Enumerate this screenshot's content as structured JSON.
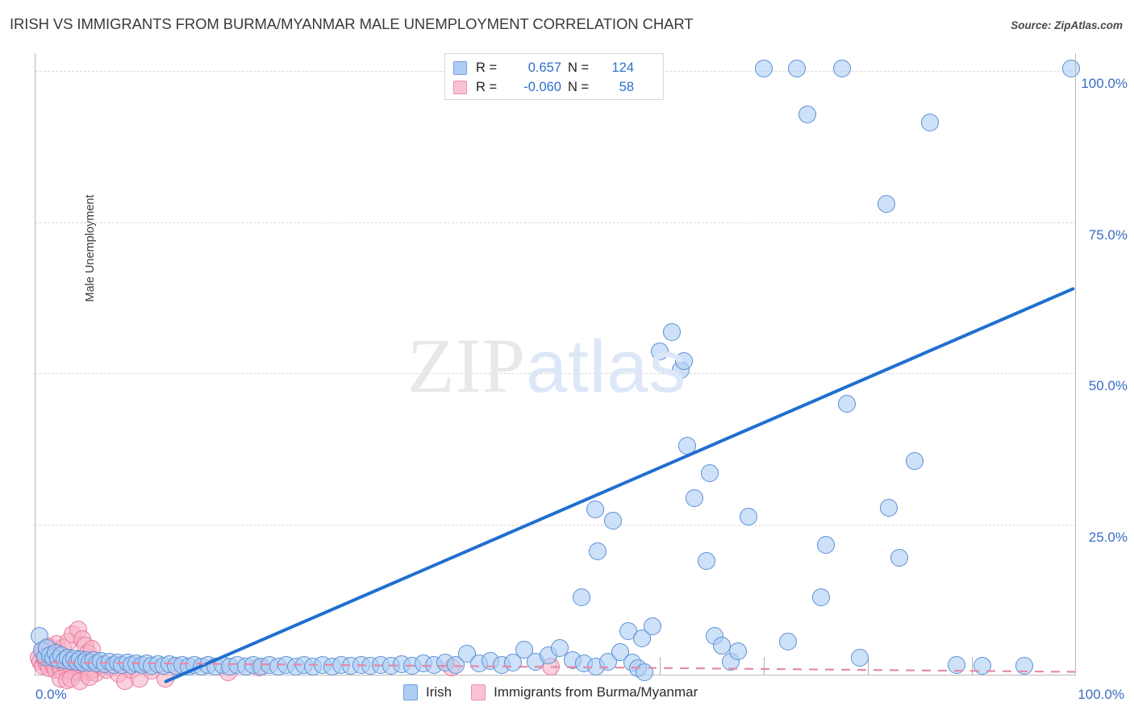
{
  "header": {
    "title": "IRISH VS IMMIGRANTS FROM BURMA/MYANMAR MALE UNEMPLOYMENT CORRELATION CHART",
    "source": "Source: ZipAtlas.com"
  },
  "watermark": {
    "part1": "ZIP",
    "part2": "atlas"
  },
  "correlation_legend": {
    "rows": [
      {
        "color": "#aecdf2",
        "r_label": "R =",
        "r_value": "0.657",
        "n_label": "N =",
        "n_value": "124"
      },
      {
        "color": "#f9c3d4",
        "r_label": "R =",
        "r_value": "-0.060",
        "n_label": "N =",
        "n_value": "58"
      }
    ]
  },
  "series_legend": [
    {
      "label": "Irish",
      "color": "#aecdf2"
    },
    {
      "label": "Immigrants from Burma/Myanmar",
      "color": "#f9c3d4"
    }
  ],
  "axes": {
    "y_title": "Male Unemployment",
    "y_ticks": [
      "100.0%",
      "75.0%",
      "50.0%",
      "25.0%"
    ],
    "x_min_label": "0.0%",
    "x_max_label": "100.0%"
  },
  "chart_data": {
    "type": "scatter",
    "title": "IRISH VS IMMIGRANTS FROM BURMA/MYANMAR MALE UNEMPLOYMENT CORRELATION CHART",
    "xlabel": "",
    "ylabel": "Male Unemployment",
    "xlim": [
      0,
      100
    ],
    "ylim": [
      0,
      103
    ],
    "grid": true,
    "legend_position": "bottom-center",
    "y_tick_values": [
      100,
      75,
      50,
      25
    ],
    "x_tick_values": [
      0,
      100
    ],
    "series": [
      {
        "name": "Irish",
        "color": "#aecdf2",
        "R": 0.657,
        "N": 124,
        "trendline": {
          "x0": 12.6,
          "y0": -1.0,
          "x1": 99.8,
          "y1": 64.0,
          "style": "solid",
          "color": "#1f6fd0"
        },
        "points": [
          [
            0.4,
            6.6
          ],
          [
            0.6,
            4.2
          ],
          [
            0.9,
            3.1
          ],
          [
            1.1,
            4.6
          ],
          [
            1.4,
            3.4
          ],
          [
            1.7,
            2.9
          ],
          [
            1.9,
            3.8
          ],
          [
            2.2,
            2.7
          ],
          [
            2.5,
            3.3
          ],
          [
            2.8,
            2.5
          ],
          [
            3.1,
            3.0
          ],
          [
            3.4,
            2.4
          ],
          [
            3.7,
            2.8
          ],
          [
            4.0,
            2.3
          ],
          [
            4.3,
            2.7
          ],
          [
            4.6,
            2.2
          ],
          [
            4.9,
            2.6
          ],
          [
            5.2,
            2.1
          ],
          [
            5.6,
            2.5
          ],
          [
            5.9,
            2.0
          ],
          [
            6.3,
            2.4
          ],
          [
            6.7,
            1.9
          ],
          [
            7.1,
            2.3
          ],
          [
            7.5,
            1.8
          ],
          [
            7.9,
            2.2
          ],
          [
            8.3,
            1.8
          ],
          [
            8.8,
            2.1
          ],
          [
            9.2,
            1.7
          ],
          [
            9.7,
            2.0
          ],
          [
            10.2,
            1.7
          ],
          [
            10.7,
            2.0
          ],
          [
            11.2,
            1.6
          ],
          [
            11.8,
            1.9
          ],
          [
            12.3,
            1.6
          ],
          [
            12.9,
            1.9
          ],
          [
            13.5,
            1.6
          ],
          [
            14.1,
            1.8
          ],
          [
            14.7,
            1.5
          ],
          [
            15.3,
            1.8
          ],
          [
            16.0,
            1.5
          ],
          [
            16.6,
            1.8
          ],
          [
            17.3,
            1.5
          ],
          [
            18.0,
            1.8
          ],
          [
            18.7,
            1.5
          ],
          [
            19.4,
            1.7
          ],
          [
            20.2,
            1.5
          ],
          [
            20.9,
            1.7
          ],
          [
            21.7,
            1.5
          ],
          [
            22.5,
            1.7
          ],
          [
            23.3,
            1.5
          ],
          [
            24.1,
            1.7
          ],
          [
            25.0,
            1.5
          ],
          [
            25.8,
            1.7
          ],
          [
            26.7,
            1.5
          ],
          [
            27.6,
            1.7
          ],
          [
            28.5,
            1.5
          ],
          [
            29.4,
            1.7
          ],
          [
            30.3,
            1.6
          ],
          [
            31.3,
            1.7
          ],
          [
            32.2,
            1.6
          ],
          [
            33.2,
            1.8
          ],
          [
            34.2,
            1.6
          ],
          [
            35.2,
            1.9
          ],
          [
            36.2,
            1.6
          ],
          [
            37.3,
            2.0
          ],
          [
            38.3,
            1.7
          ],
          [
            39.4,
            2.2
          ],
          [
            40.4,
            1.7
          ],
          [
            41.5,
            3.6
          ],
          [
            42.6,
            2.0
          ],
          [
            43.7,
            2.4
          ],
          [
            44.8,
            1.8
          ],
          [
            45.9,
            2.2
          ],
          [
            47.0,
            4.3
          ],
          [
            48.1,
            2.3
          ],
          [
            49.3,
            3.4
          ],
          [
            50.4,
            4.6
          ],
          [
            51.6,
            2.6
          ],
          [
            52.7,
            2.0
          ],
          [
            53.9,
            1.5
          ],
          [
            55.0,
            2.3
          ],
          [
            56.2,
            3.9
          ],
          [
            57.4,
            2.1
          ],
          [
            57.9,
            1.2
          ],
          [
            58.5,
            0.6
          ],
          [
            52.5,
            13.0
          ],
          [
            53.8,
            27.5
          ],
          [
            54.0,
            20.6
          ],
          [
            55.5,
            25.6
          ],
          [
            57.0,
            7.3
          ],
          [
            58.3,
            6.2
          ],
          [
            59.3,
            8.1
          ],
          [
            60.0,
            53.7
          ],
          [
            61.2,
            56.8
          ],
          [
            62.0,
            50.6
          ],
          [
            62.3,
            52.1
          ],
          [
            62.6,
            38.0
          ],
          [
            63.3,
            29.3
          ],
          [
            64.5,
            18.9
          ],
          [
            64.8,
            33.5
          ],
          [
            65.3,
            6.5
          ],
          [
            66.0,
            5.0
          ],
          [
            66.8,
            2.3
          ],
          [
            67.5,
            4.0
          ],
          [
            68.5,
            26.3
          ],
          [
            70.0,
            100.5
          ],
          [
            72.3,
            5.6
          ],
          [
            73.2,
            100.5
          ],
          [
            74.2,
            92.8
          ],
          [
            75.5,
            12.9
          ],
          [
            76.0,
            21.6
          ],
          [
            77.5,
            100.5
          ],
          [
            78.0,
            45.0
          ],
          [
            79.2,
            3.0
          ],
          [
            81.8,
            78.0
          ],
          [
            82.0,
            27.8
          ],
          [
            83.0,
            19.5
          ],
          [
            84.5,
            35.5
          ],
          [
            86.0,
            91.5
          ],
          [
            88.5,
            1.7
          ],
          [
            91.0,
            1.6
          ],
          [
            95.0,
            1.6
          ],
          [
            99.5,
            100.5
          ]
        ]
      },
      {
        "name": "Immigrants from Burma/Myanmar",
        "color": "#f9c3d4",
        "R": -0.06,
        "N": 58,
        "trendline": {
          "x0": 0,
          "y0": 2.2,
          "x1": 100,
          "y1": 0.6,
          "style": "dashed",
          "color": "#e58aa9"
        },
        "points": [
          [
            0.3,
            3.0
          ],
          [
            0.5,
            2.3
          ],
          [
            0.7,
            1.6
          ],
          [
            0.9,
            2.8
          ],
          [
            1.1,
            2.0
          ],
          [
            1.3,
            1.2
          ],
          [
            1.5,
            2.6
          ],
          [
            1.7,
            1.8
          ],
          [
            1.9,
            1.0
          ],
          [
            2.1,
            2.5
          ],
          [
            2.3,
            1.6
          ],
          [
            2.5,
            0.8
          ],
          [
            2.7,
            2.3
          ],
          [
            2.9,
            1.5
          ],
          [
            3.1,
            0.7
          ],
          [
            3.3,
            2.2
          ],
          [
            3.5,
            1.4
          ],
          [
            3.8,
            0.6
          ],
          [
            4.0,
            2.1
          ],
          [
            4.2,
            1.3
          ],
          [
            4.4,
            0.5
          ],
          [
            4.6,
            2.0
          ],
          [
            4.9,
            1.2
          ],
          [
            5.1,
            0.5
          ],
          [
            5.3,
            2.0
          ],
          [
            5.6,
            1.1
          ],
          [
            5.8,
            0.4
          ],
          [
            2.0,
            5.2
          ],
          [
            2.6,
            4.6
          ],
          [
            3.2,
            5.6
          ],
          [
            3.6,
            6.8
          ],
          [
            4.1,
            7.6
          ],
          [
            4.5,
            6.0
          ],
          [
            4.8,
            4.9
          ],
          [
            5.0,
            3.8
          ],
          [
            5.4,
            4.4
          ],
          [
            1.6,
            4.0
          ],
          [
            1.2,
            4.8
          ],
          [
            0.8,
            4.0
          ],
          [
            2.4,
            -0.6
          ],
          [
            3.0,
            -0.8
          ],
          [
            3.4,
            -0.5
          ],
          [
            4.3,
            -0.9
          ],
          [
            5.2,
            -0.3
          ],
          [
            6.2,
            1.7
          ],
          [
            6.8,
            0.9
          ],
          [
            7.4,
            1.4
          ],
          [
            8.0,
            0.3
          ],
          [
            8.6,
            -0.9
          ],
          [
            9.2,
            1.0
          ],
          [
            10.0,
            -0.5
          ],
          [
            11.2,
            0.8
          ],
          [
            12.5,
            -0.6
          ],
          [
            13.5,
            1.6
          ],
          [
            18.5,
            0.6
          ],
          [
            21.5,
            1.4
          ],
          [
            40.0,
            1.3
          ],
          [
            49.5,
            1.5
          ]
        ]
      }
    ]
  }
}
